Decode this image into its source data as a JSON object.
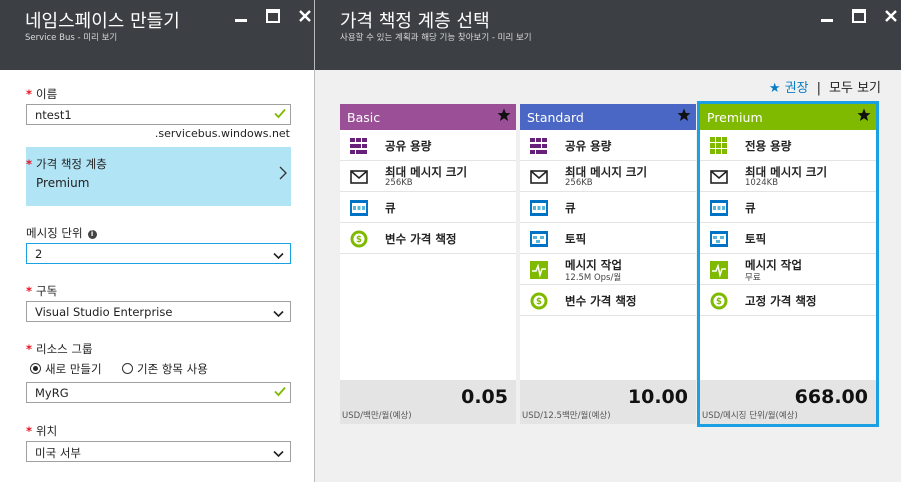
{
  "left": {
    "title": "네임스페이스 만들기",
    "subtitle": "Service Bus - 미리 보기",
    "name": {
      "label": "이름",
      "value": "ntest1",
      "suffix": ".servicebus.windows.net"
    },
    "tier": {
      "label": "가격 책정 계층",
      "value": "Premium"
    },
    "units": {
      "label": "메시징 단위",
      "value": "2"
    },
    "subscription": {
      "label": "구독",
      "value": "Visual Studio Enterprise"
    },
    "rg": {
      "label": "리소스 그룹",
      "opt_new": "새로 만들기",
      "opt_existing": "기존 항목 사용",
      "value": "MyRG"
    },
    "location": {
      "label": "위치",
      "value": "미국 서부"
    }
  },
  "right": {
    "title": "가격 책정 계층 선택",
    "subtitle": "사용할 수 있는 계획과 해당 기능 찾아보기 - 미리 보기",
    "recommended": "권장",
    "separator": "|",
    "view_all": "모두 보기",
    "cards": [
      {
        "name": "Basic",
        "color": "#9b4f96",
        "features": [
          {
            "icon": "shared-capacity-icon",
            "title": "공유 용량",
            "sub": ""
          },
          {
            "icon": "envelope-icon",
            "title": "최대 메시지 크기",
            "sub": "256KB"
          },
          {
            "icon": "queue-icon",
            "title": "큐",
            "sub": ""
          },
          {
            "icon": "variable-pricing-icon",
            "title": "변수 가격 책정",
            "sub": ""
          }
        ],
        "price": "0.05",
        "unit": "USD/백만/월(예상)"
      },
      {
        "name": "Standard",
        "color": "#4a67c5",
        "features": [
          {
            "icon": "shared-capacity-icon",
            "title": "공유 용량",
            "sub": ""
          },
          {
            "icon": "envelope-icon",
            "title": "최대 메시지 크기",
            "sub": "256KB"
          },
          {
            "icon": "queue-icon",
            "title": "큐",
            "sub": ""
          },
          {
            "icon": "topic-icon",
            "title": "토픽",
            "sub": ""
          },
          {
            "icon": "messaging-ops-icon",
            "title": "메시지 작업",
            "sub": "12.5M Ops/월"
          },
          {
            "icon": "variable-pricing-icon",
            "title": "변수 가격 책정",
            "sub": ""
          }
        ],
        "price": "10.00",
        "unit": "USD/12.5백만/월(예상)"
      },
      {
        "name": "Premium",
        "color": "#7fba00",
        "features": [
          {
            "icon": "dedicated-capacity-icon",
            "title": "전용 용량",
            "sub": ""
          },
          {
            "icon": "envelope-icon",
            "title": "최대 메시지 크기",
            "sub": "1024KB"
          },
          {
            "icon": "queue-icon",
            "title": "큐",
            "sub": ""
          },
          {
            "icon": "topic-icon",
            "title": "토픽",
            "sub": ""
          },
          {
            "icon": "messaging-ops-icon",
            "title": "메시지 작업",
            "sub": "무료"
          },
          {
            "icon": "fixed-pricing-icon",
            "title": "고정 가격 책정",
            "sub": ""
          }
        ],
        "price": "668.00",
        "unit": "USD/메시징 단위/월(예상)"
      }
    ]
  },
  "colors": {
    "header_bg": "#3c4044",
    "selected_outline": "#1ba1e2",
    "tier_selected_bg": "#b1e4f5",
    "link": "#0a7ec3",
    "required": "#e81123",
    "valid_check": "#7fba00"
  }
}
